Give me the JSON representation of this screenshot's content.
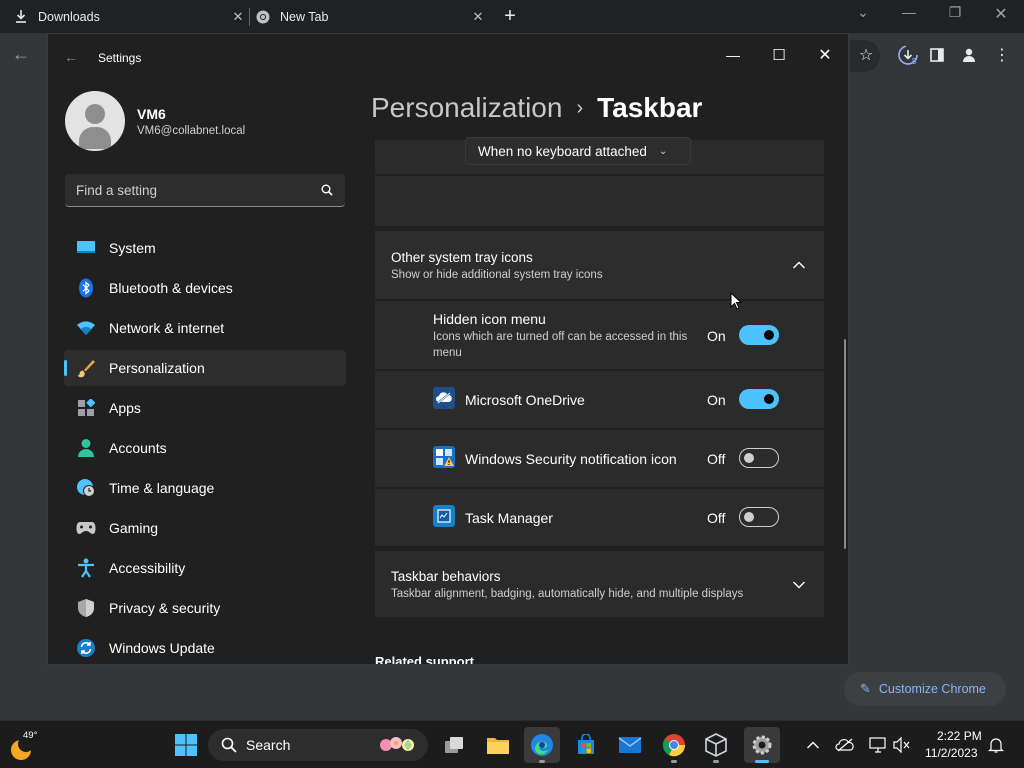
{
  "chrome": {
    "tabs": [
      {
        "label": "Downloads",
        "icon": "download-icon"
      },
      {
        "label": "New Tab",
        "icon": "chrome-icon"
      }
    ],
    "customize_label": "Customize Chrome",
    "downloads_badge": "5"
  },
  "settings": {
    "window_title": "Settings",
    "user": {
      "name": "VM6",
      "email": "VM6@collabnet.local"
    },
    "search_placeholder": "Find a setting",
    "nav": [
      {
        "label": "System",
        "icon": "monitor-icon"
      },
      {
        "label": "Bluetooth & devices",
        "icon": "bluetooth-icon"
      },
      {
        "label": "Network & internet",
        "icon": "wifi-icon"
      },
      {
        "label": "Personalization",
        "icon": "brush-icon",
        "active": true
      },
      {
        "label": "Apps",
        "icon": "apps-icon"
      },
      {
        "label": "Accounts",
        "icon": "person-icon"
      },
      {
        "label": "Time & language",
        "icon": "globe-clock-icon"
      },
      {
        "label": "Gaming",
        "icon": "gamepad-icon"
      },
      {
        "label": "Accessibility",
        "icon": "accessibility-icon"
      },
      {
        "label": "Privacy & security",
        "icon": "shield-icon"
      },
      {
        "label": "Windows Update",
        "icon": "update-icon"
      }
    ],
    "breadcrumb": {
      "parent": "Personalization",
      "separator": "›",
      "current": "Taskbar"
    },
    "keyboard_dropdown": "When no keyboard attached",
    "tray_section": {
      "title": "Other system tray icons",
      "subtitle": "Show or hide additional system tray icons",
      "rows": [
        {
          "title": "Hidden icon menu",
          "subtitle": "Icons which are turned off can be accessed in this menu",
          "state": "On",
          "on": true
        },
        {
          "title": "Microsoft OneDrive",
          "state": "On",
          "on": true,
          "icon": "onedrive-icon"
        },
        {
          "title": "Windows Security notification icon",
          "state": "Off",
          "on": false,
          "icon": "windows-security-icon"
        },
        {
          "title": "Task Manager",
          "state": "Off",
          "on": false,
          "icon": "task-manager-icon"
        }
      ]
    },
    "behaviors_section": {
      "title": "Taskbar behaviors",
      "subtitle": "Taskbar alignment, badging, automatically hide, and multiple displays"
    },
    "related_support": "Related support"
  },
  "taskbar": {
    "weather_temp": "49°",
    "search_label": "Search",
    "time": "2:22 PM",
    "date": "11/2/2023"
  },
  "colors": {
    "accent": "#4cc2ff",
    "chrome_link": "#8ab4f8"
  }
}
